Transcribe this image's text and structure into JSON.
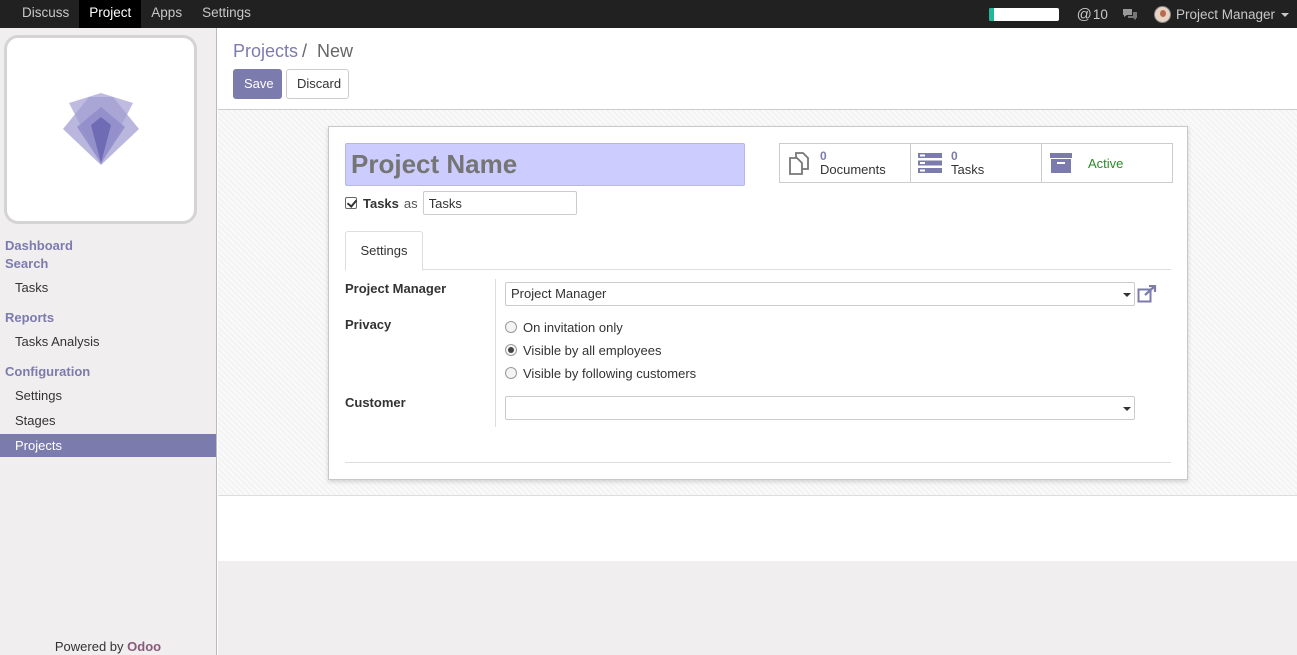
{
  "topbar": {
    "menu": [
      "Discuss",
      "Project",
      "Apps",
      "Settings"
    ],
    "active_menu": "Project",
    "progress_fraction": 0.08,
    "mention_count": "10",
    "user_name": "Project Manager",
    "icons": {
      "mention": "at-icon",
      "chat": "chat-bubbles-icon",
      "avatar": "user-avatar"
    }
  },
  "sidebar": {
    "sections": [
      {
        "title": "Dashboard"
      },
      {
        "title": "Search",
        "items": [
          "Tasks"
        ]
      },
      {
        "title": "Reports",
        "items": [
          "Tasks Analysis"
        ]
      },
      {
        "title": "Configuration",
        "items": [
          "Settings",
          "Stages",
          "Projects"
        ]
      }
    ],
    "active_item": "Projects",
    "powered_prefix": "Powered by",
    "powered_brand": "Odoo"
  },
  "control_panel": {
    "breadcrumb": [
      "Projects",
      "New"
    ],
    "breadcrumb_separator": "/",
    "save_label": "Save",
    "discard_label": "Discard"
  },
  "form": {
    "name_placeholder": "Project Name",
    "tasks_checkbox": {
      "checked": true,
      "label": "Tasks",
      "as_text": "as",
      "alias_value": "Tasks"
    },
    "smart_buttons": [
      {
        "count": "0",
        "label": "Documents",
        "icon": "documents-icon"
      },
      {
        "count": "0",
        "label": "Tasks",
        "icon": "tasks-list-icon"
      },
      {
        "label": "Active",
        "icon": "archive-box-icon"
      }
    ],
    "tab_label": "Settings",
    "fields": {
      "project_manager": {
        "label": "Project Manager",
        "value": "Project Manager"
      },
      "privacy": {
        "label": "Privacy",
        "options": [
          "On invitation only",
          "Visible by all employees",
          "Visible by following customers"
        ],
        "selected_index": 1
      },
      "customer": {
        "label": "Customer",
        "value": ""
      }
    }
  },
  "colors": {
    "brand": "#7c7bad",
    "topbar": "#212121",
    "name_input_bg": "#ccccff",
    "active_green": "#2a8a2a",
    "odoo": "#875a7b"
  }
}
